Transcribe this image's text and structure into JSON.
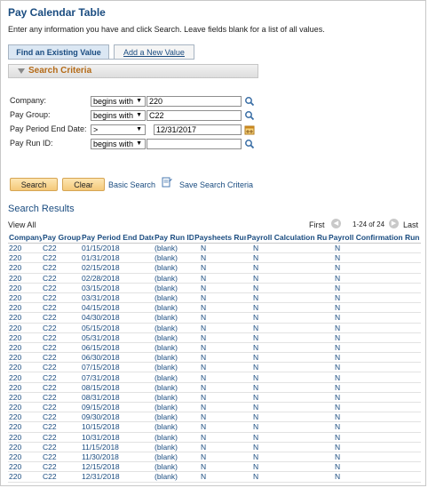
{
  "page": {
    "title": "Pay Calendar Table",
    "instructions": "Enter any information you have and click Search. Leave fields blank for a list of all values."
  },
  "tabs": [
    {
      "label": "Find an Existing Value",
      "active": true
    },
    {
      "label": "Add a New Value",
      "active": false
    }
  ],
  "criteria": {
    "header": "Search Criteria",
    "fields": [
      {
        "label": "Company:",
        "operator": "begins with",
        "value": "220",
        "icon": "search-icon"
      },
      {
        "label": "Pay Group:",
        "operator": "begins with",
        "value": "C22",
        "icon": "search-icon"
      },
      {
        "label": "Pay Period End Date:",
        "operator": ">",
        "value": "12/31/2017",
        "icon": "calendar-icon"
      },
      {
        "label": "Pay Run ID:",
        "operator": "begins with",
        "value": "",
        "icon": "search-icon"
      }
    ]
  },
  "actions": {
    "search": "Search",
    "clear": "Clear",
    "basic_search": "Basic Search",
    "save_criteria": "Save Search Criteria"
  },
  "results": {
    "title": "Search Results",
    "view_all": "View All",
    "first": "First",
    "range": "1-24 of 24",
    "last": "Last",
    "columns": [
      "Company",
      "Pay Group",
      "Pay Period End Date",
      "Pay Run ID",
      "Paysheets Run",
      "Payroll Calculation Run",
      "Payroll Confirmation Run"
    ],
    "rows": [
      [
        "220",
        "C22",
        "01/15/2018",
        "(blank)",
        "N",
        "N",
        "N"
      ],
      [
        "220",
        "C22",
        "01/31/2018",
        "(blank)",
        "N",
        "N",
        "N"
      ],
      [
        "220",
        "C22",
        "02/15/2018",
        "(blank)",
        "N",
        "N",
        "N"
      ],
      [
        "220",
        "C22",
        "02/28/2018",
        "(blank)",
        "N",
        "N",
        "N"
      ],
      [
        "220",
        "C22",
        "03/15/2018",
        "(blank)",
        "N",
        "N",
        "N"
      ],
      [
        "220",
        "C22",
        "03/31/2018",
        "(blank)",
        "N",
        "N",
        "N"
      ],
      [
        "220",
        "C22",
        "04/15/2018",
        "(blank)",
        "N",
        "N",
        "N"
      ],
      [
        "220",
        "C22",
        "04/30/2018",
        "(blank)",
        "N",
        "N",
        "N"
      ],
      [
        "220",
        "C22",
        "05/15/2018",
        "(blank)",
        "N",
        "N",
        "N"
      ],
      [
        "220",
        "C22",
        "05/31/2018",
        "(blank)",
        "N",
        "N",
        "N"
      ],
      [
        "220",
        "C22",
        "06/15/2018",
        "(blank)",
        "N",
        "N",
        "N"
      ],
      [
        "220",
        "C22",
        "06/30/2018",
        "(blank)",
        "N",
        "N",
        "N"
      ],
      [
        "220",
        "C22",
        "07/15/2018",
        "(blank)",
        "N",
        "N",
        "N"
      ],
      [
        "220",
        "C22",
        "07/31/2018",
        "(blank)",
        "N",
        "N",
        "N"
      ],
      [
        "220",
        "C22",
        "08/15/2018",
        "(blank)",
        "N",
        "N",
        "N"
      ],
      [
        "220",
        "C22",
        "08/31/2018",
        "(blank)",
        "N",
        "N",
        "N"
      ],
      [
        "220",
        "C22",
        "09/15/2018",
        "(blank)",
        "N",
        "N",
        "N"
      ],
      [
        "220",
        "C22",
        "09/30/2018",
        "(blank)",
        "N",
        "N",
        "N"
      ],
      [
        "220",
        "C22",
        "10/15/2018",
        "(blank)",
        "N",
        "N",
        "N"
      ],
      [
        "220",
        "C22",
        "10/31/2018",
        "(blank)",
        "N",
        "N",
        "N"
      ],
      [
        "220",
        "C22",
        "11/15/2018",
        "(blank)",
        "N",
        "N",
        "N"
      ],
      [
        "220",
        "C22",
        "11/30/2018",
        "(blank)",
        "N",
        "N",
        "N"
      ],
      [
        "220",
        "C22",
        "12/15/2018",
        "(blank)",
        "N",
        "N",
        "N"
      ],
      [
        "220",
        "C22",
        "12/31/2018",
        "(blank)",
        "N",
        "N",
        "N"
      ]
    ]
  },
  "colors": {
    "title": "#1a4c80",
    "criteria_header": "#b46a16",
    "button": "#f4c97a"
  }
}
